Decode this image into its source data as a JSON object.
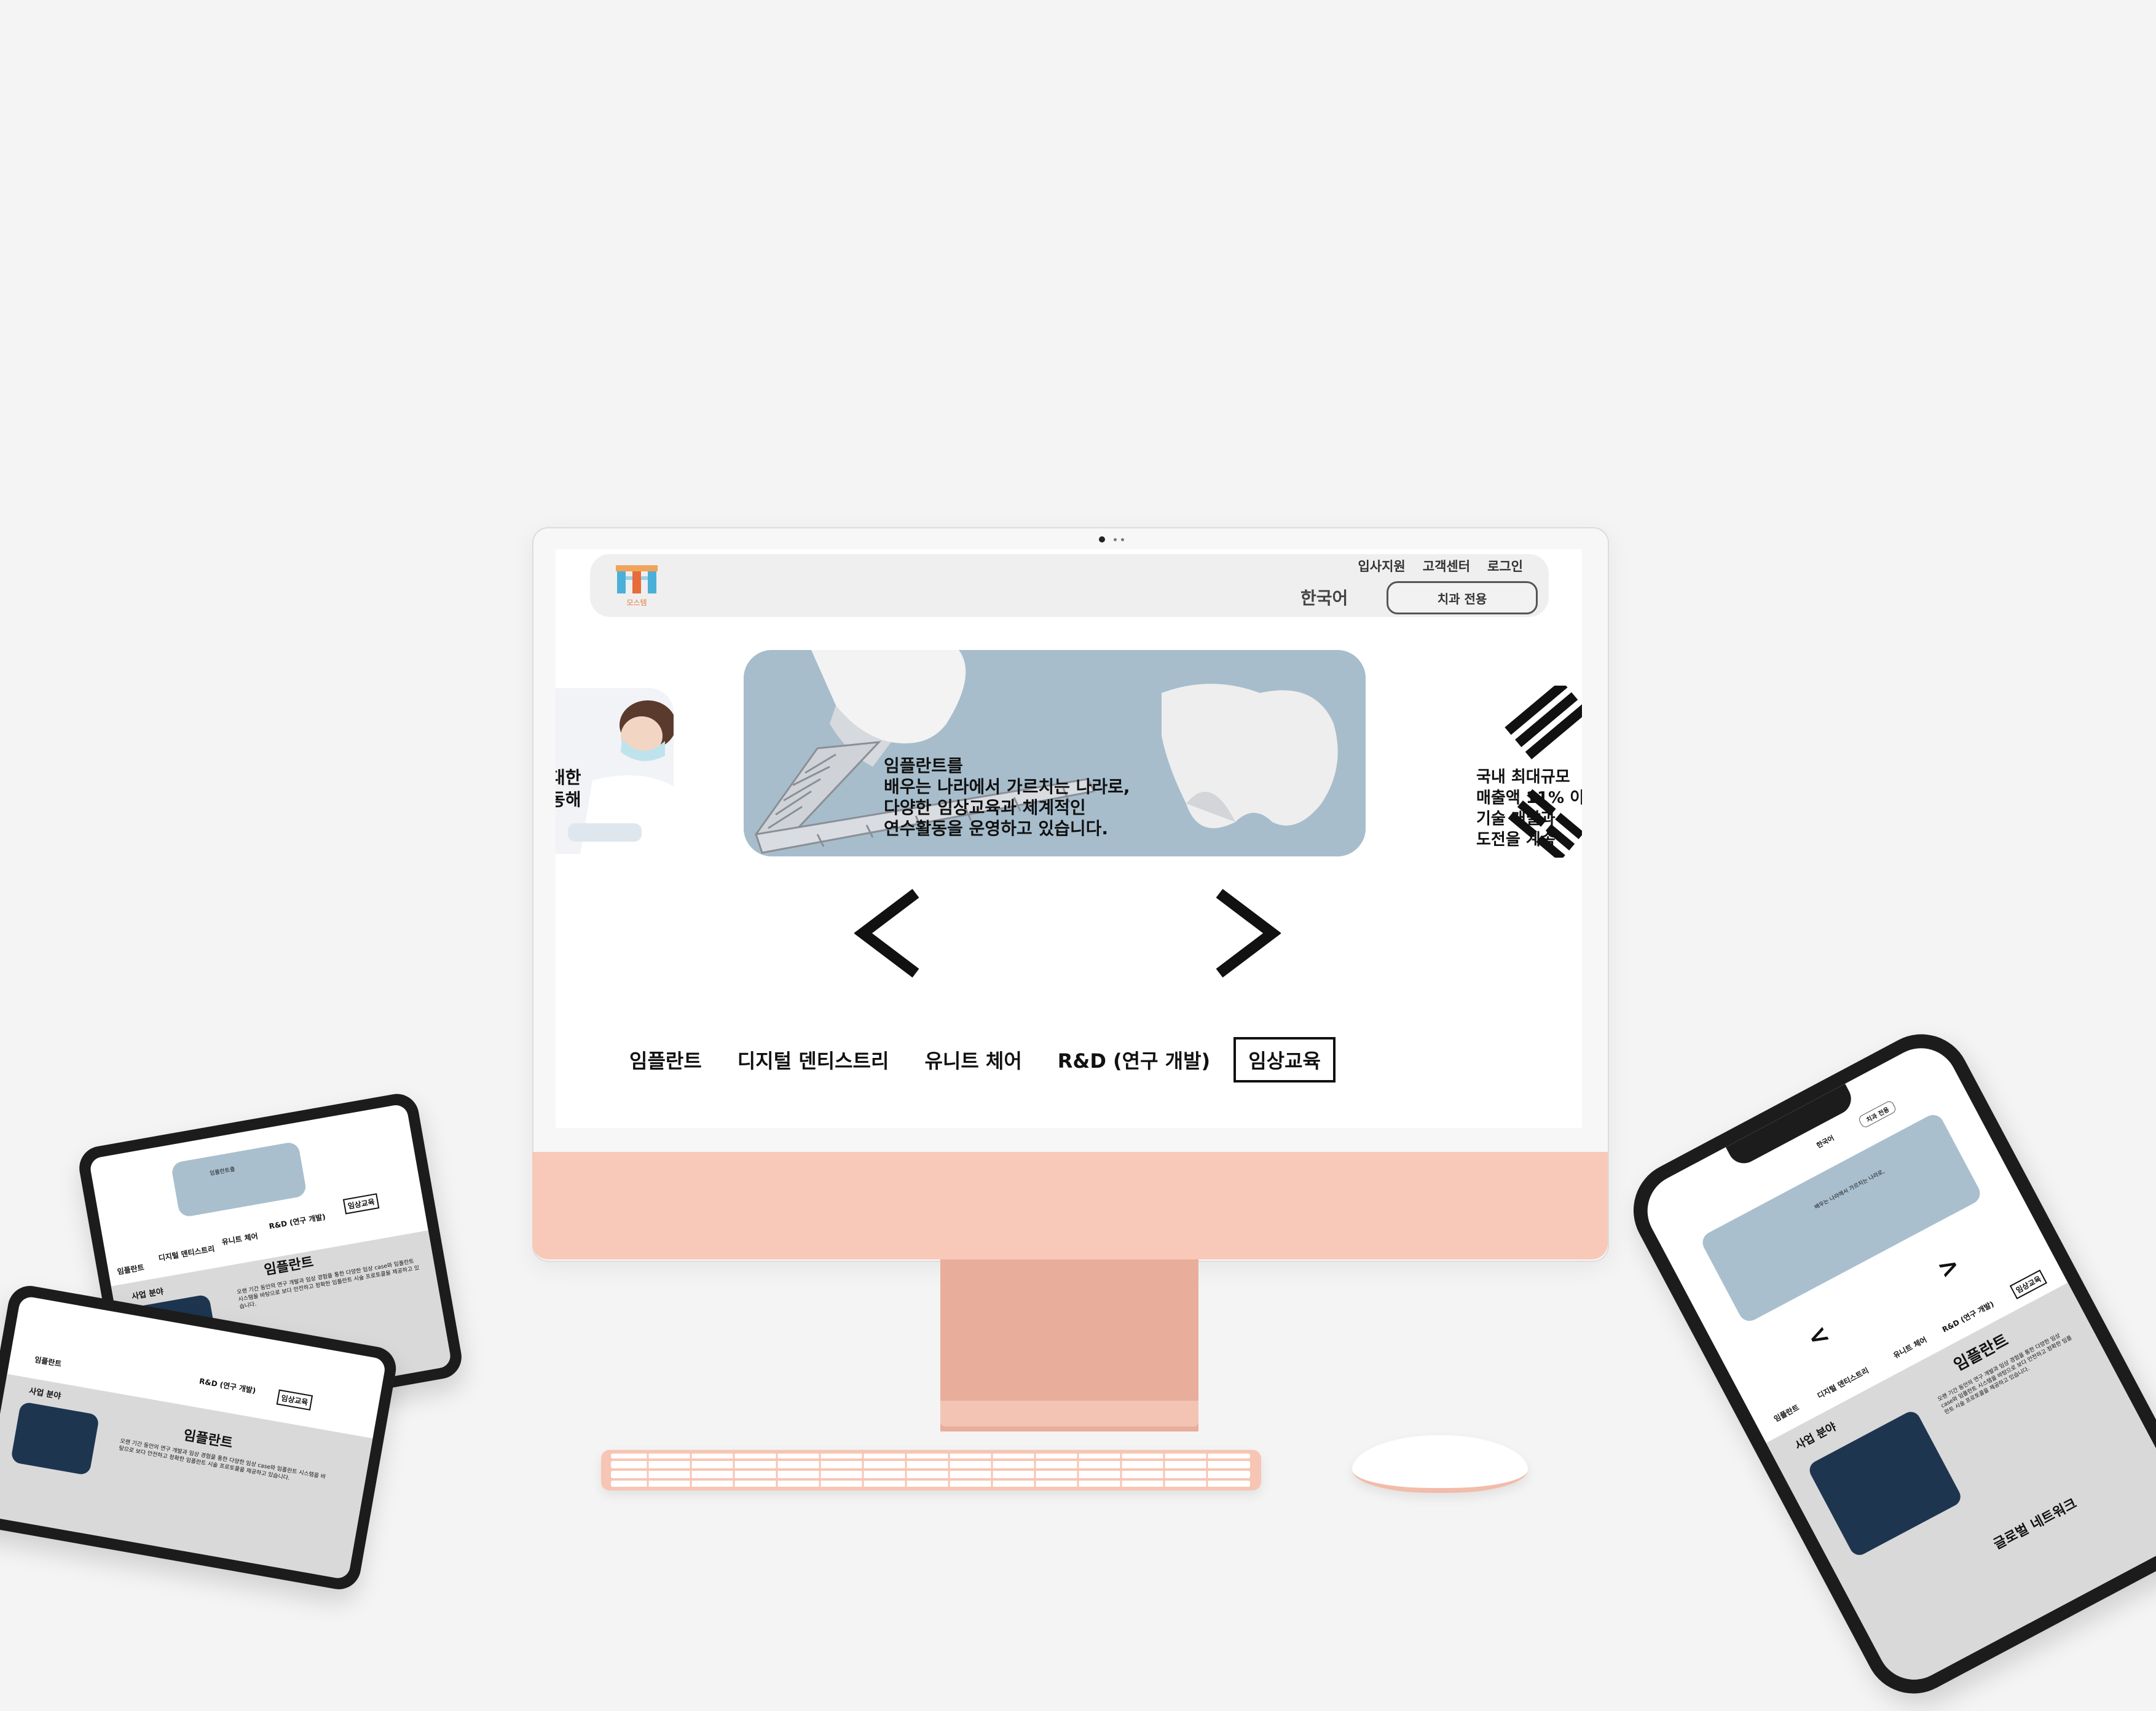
{
  "header": {
    "logo_text": "모스템",
    "util_links": [
      "입사지원",
      "고객센터",
      "로그인"
    ],
    "lang_label": "한국어",
    "cta_label": "치과 전용"
  },
  "carousel": {
    "left_text": [
      "대한",
      "동해"
    ],
    "center_text": [
      "임플란트를",
      "배우는 나라에서 가르치는 나라로,",
      "다양한 임상교육과 체계적인",
      "연수활동을 운영하고 있습니다."
    ],
    "right_text": [
      "국내 최대규모",
      "매출액 11% 이",
      "기술 개발과",
      "도전을 계속"
    ],
    "prev_arrow": "<",
    "next_arrow": ">"
  },
  "tabs": [
    {
      "label": "임플란트",
      "active": false
    },
    {
      "label": "디지털 덴티스트리",
      "active": false
    },
    {
      "label": "유니트 체어",
      "active": false
    },
    {
      "label": "R&D (연구 개발)",
      "active": false
    },
    {
      "label": "임상교육",
      "active": true
    }
  ],
  "mobile": {
    "section_title": "사업 분야",
    "section_heading": "임플란트",
    "body_text": "오랜 기간 동안의 연구 개발과 임상 경험을 통한 다양한 임상 case와 임플란트 시스템을 바탕으로 보다 안전하고 정확한 임플란트 시술 프로토콜을 제공하고 있습니다.",
    "footer_heading": "글로벌 네트워크"
  },
  "colors": {
    "accent": "#f8c9b9",
    "stand": "#e9ad9b",
    "header_bg": "#efefef"
  }
}
